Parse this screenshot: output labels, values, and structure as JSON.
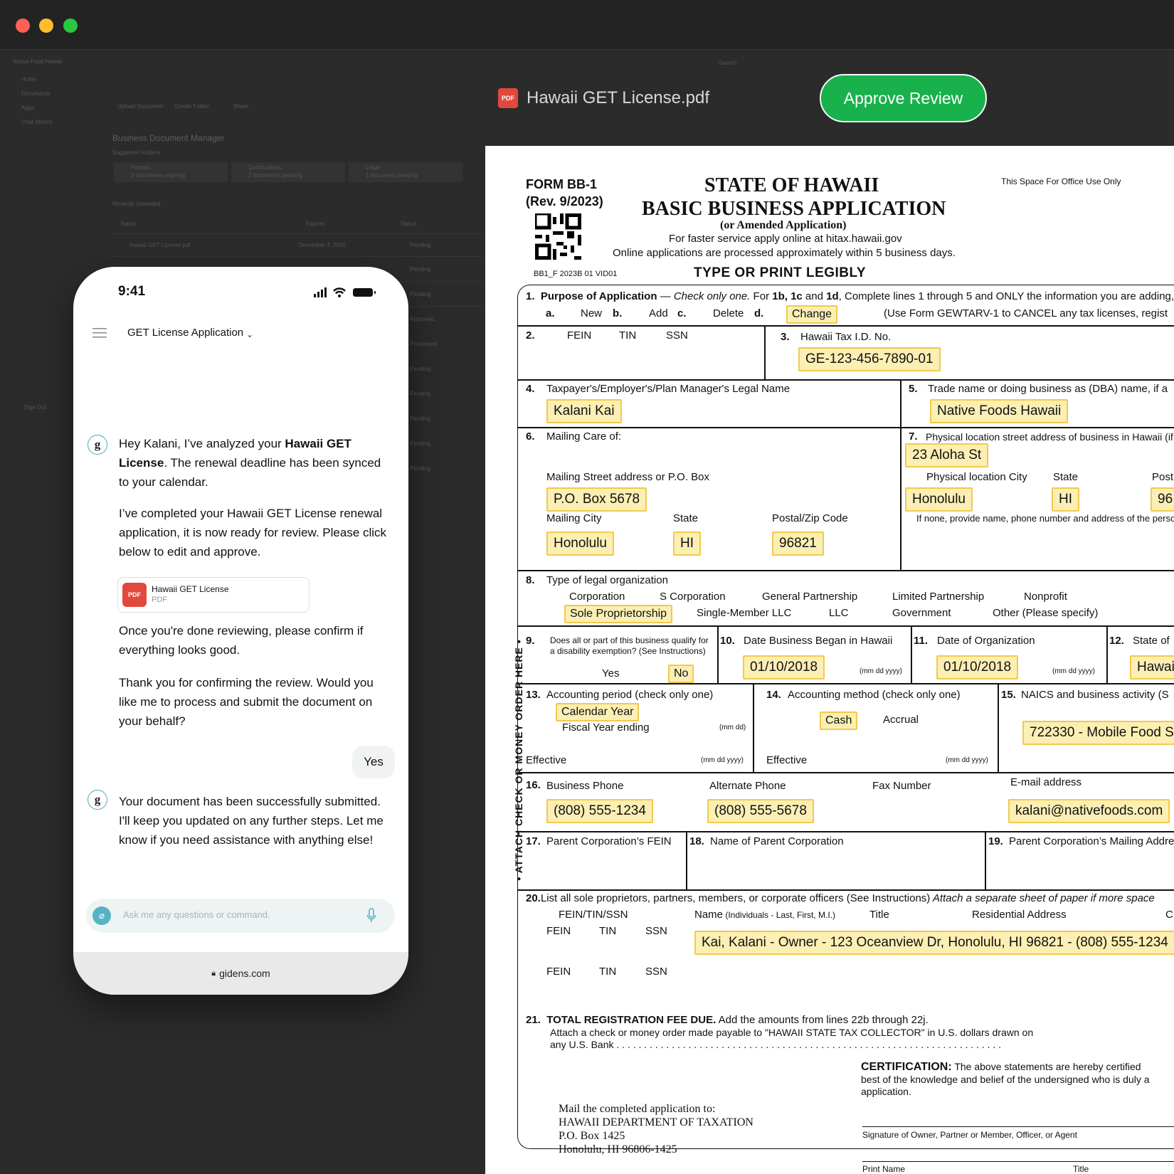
{
  "window": {
    "file_name": "Hawaii GET License.pdf",
    "file_badge": "PDF",
    "approve_label": "Approve Review"
  },
  "background_app": {
    "brand": "Native Food Hawaii",
    "nav": [
      "Home",
      "Documents",
      "Apps",
      "Chat History"
    ],
    "sign_out": "Sign Out",
    "actions": [
      "Upload Document",
      "Create Folder",
      "Share"
    ],
    "search_placeholder": "Search",
    "title": "Business Document Manager",
    "suggested": "Suggested Folders",
    "folders": [
      {
        "name": "Permits",
        "sub": "3 documents expiring"
      },
      {
        "name": "Certifications",
        "sub": "2 documents pending"
      },
      {
        "name": "Legal",
        "sub": "1 document pending"
      }
    ],
    "recent": "Recently Uploaded",
    "columns": [
      "Name",
      "Expires",
      "Status"
    ],
    "first_row": {
      "name": "Hawaii GET License.pdf",
      "date": "December 4, 2025"
    },
    "statuses": [
      "Pending",
      "Pending",
      "Pending",
      "Approved",
      "Processed",
      "Pending",
      "Pending",
      "Pending",
      "Pending",
      "Pending"
    ]
  },
  "phone": {
    "time": "9:41",
    "header_title": "GET License Application",
    "msg1_a": "Hey Kalani, I’ve analyzed your ",
    "msg1_b": "Hawaii GET License",
    "msg1_c": ". The renewal deadline has been synced to your calendar.",
    "msg2": "I’ve completed your Hawaii GET License renewal application, it is now ready for review. Please click below to edit and approve.",
    "attachment": {
      "badge": "PDF",
      "title": "Hawaii GET License",
      "type": "PDF"
    },
    "msg3": "Once you're done reviewing, please confirm if everything looks good.",
    "msg4": "Thank you for confirming the review. Would you like me to process and submit the document on your behalf?",
    "user_reply": "Yes",
    "msg5": "Your document has been successfully submitted. I'll keep you updated on any further steps. Let me know if you need assistance with anything else!",
    "input_placeholder": "Ask me any questions or command.",
    "url": "gidens.com",
    "avatar_letter": "g"
  },
  "form": {
    "form_id": "FORM BB-1",
    "rev": "(Rev. 9/2023)",
    "state": "STATE OF HAWAII",
    "title": "BASIC BUSINESS APPLICATION",
    "subtitle": "(or Amended Application)",
    "faster": "For faster service apply online at hitax.hawaii.gov",
    "online": "Online applications are processed approximately within 5 business days.",
    "office": "This Space For Office Use Only",
    "code": "BB1_F 2023B 01 VID01",
    "legibly": "TYPE OR PRINT LEGIBLY",
    "side": "• ATTACH CHECK OR MONEY ORDER HERE •",
    "l1_num": "1.",
    "l1_label": "Purpose of Application",
    "l1_check": " — Check only one.",
    "l1_rest_a": "  For ",
    "l1_rest_b": "1b, 1c",
    "l1_rest_c": " and ",
    "l1_rest_d": "1d",
    "l1_rest_e": ", Complete lines 1 through 5 and ONLY the information you are adding,",
    "opt_a": "a.",
    "opt_new": "New",
    "opt_b": "b.",
    "opt_add": "Add",
    "opt_c": "c.",
    "opt_delete": "Delete",
    "opt_d": "d.",
    "change": "Change",
    "cancel_note": "(Use Form GEWTARV-1 to CANCEL any tax licenses, regist",
    "l2_num": "2.",
    "fein": "FEIN",
    "tin": "TIN",
    "ssn": "SSN",
    "l3_num": "3.",
    "l3_label": "Hawaii Tax I.D. No.",
    "tax_id": "GE-123-456-7890-01",
    "l4_num": "4.",
    "l4_label": "Taxpayer's/Employer's/Plan Manager's Legal Name",
    "legal_name": "Kalani Kai",
    "l5_num": "5.",
    "l5_label": "Trade name or doing business as (DBA) name, if a",
    "dba": "Native Foods Hawaii",
    "l6_num": "6.",
    "l6_label": "Mailing Care of:",
    "mail_street_label": "Mailing Street address or P.O. Box",
    "mail_street": "P.O. Box 5678",
    "mail_city_label": "Mailing City",
    "mail_city": "Honolulu",
    "state_label": "State",
    "mail_state": "HI",
    "zip_label": "Postal/Zip Code",
    "mail_zip": "96821",
    "l7_num": "7.",
    "l7_label": "Physical location street address of business in Hawaii (if",
    "phys_street": "23 Aloha St",
    "phys_city_label": "Physical location City",
    "phys_city": "Honolulu",
    "phys_state": "HI",
    "phys_zip_label": "Post",
    "phys_zip": "96",
    "l7_note": "If none, provide name, phone number and address of the person",
    "l8_num": "8.",
    "l8_label": "Type of legal organization",
    "org": {
      "corp": "Corporation",
      "scorp": "S Corporation",
      "gp": "General Partnership",
      "lp": "Limited Partnership",
      "np": "Nonprofit",
      "sole": "Sole Proprietorship",
      "smllc": "Single-Member LLC",
      "llc": "LLC",
      "gov": "Government",
      "other": "Other (Please specify)"
    },
    "l9_num": "9.",
    "l9_label_1": "Does all or part of this business qualify for",
    "l9_label_2": "a disability exemption? (See Instructions)",
    "yes": "Yes",
    "no": "No",
    "l10_num": "10.",
    "l10_label": "Date Business Began in Hawaii",
    "date_began": "01/10/2018",
    "mmddyyyy": "(mm dd yyyy)",
    "l11_num": "11.",
    "l11_label": "Date of Organization",
    "date_org": "01/10/2018",
    "l12_num": "12.",
    "l12_label": "State of",
    "l12_value": "Hawai",
    "l13_num": "13.",
    "l13_label": "Accounting period (check only one)",
    "calendar_year": "Calendar Year",
    "fiscal": "Fiscal Year ending",
    "mmdd": "(mm dd)",
    "effective": "Effective",
    "l14_num": "14.",
    "l14_label": "Accounting method (check only one)",
    "cash": "Cash",
    "accrual": "Accrual",
    "l15_num": "15.",
    "l15_label": "NAICS and business activity (S",
    "naics": "722330 - Mobile Food Se",
    "l16_num": "16.",
    "l16_label": "Business Phone",
    "phone": "(808) 555-1234",
    "alt_label": "Alternate Phone",
    "alt_phone": "(808) 555-5678",
    "fax_label": "Fax Number",
    "email_label": "E-mail address",
    "email": "kalani@nativefoods.com",
    "l17_num": "17.",
    "l17_label": "Parent Corporation’s FEIN",
    "l18_num": "18.",
    "l18_label": "Name of Parent Corporation",
    "l19_num": "19.",
    "l19_label": "Parent Corporation’s Mailing Addre",
    "l20_num": "20.",
    "l20_label": "List all sole proprietors, partners, members, or corporate officers (See Instructions)",
    "l20_italic": " Attach a separate sheet of paper if more space",
    "feintinssn": "FEIN/TIN/SSN",
    "name_label": "Name",
    "name_sub": " (Individuals - Last, First, M.I.)",
    "title_label": "Title",
    "res_label": "Residential Address",
    "c_label": "C",
    "officer": "Kai, Kalani - Owner - 123 Oceanview Dr, Honolulu, HI 96821 - (808) 555-1234",
    "l21_num": "21.",
    "l21_label": "TOTAL REGISTRATION FEE DUE.",
    "l21_rest": " Add the amounts from lines 22b through 22j.",
    "l21_line2": "Attach a check or money order made payable to \"HAWAII STATE TAX COLLECTOR\" in U.S. dollars drawn on",
    "l21_line3": "any U.S. Bank . . . . . . . . . . . . . . . . . . . . . . . . . . . . . . . . . . . . . . . . . . . . . . . . . . . . . . . . . . . . . . . . . . . . . .",
    "cert_label": "CERTIFICATION:",
    "cert_1": " The above statements are hereby certified",
    "cert_2": "best of the knowledge and belief of the undersigned who is duly a",
    "cert_3": "application.",
    "mail_1": "Mail the completed application to:",
    "mail_2": "HAWAII DEPARTMENT OF TAXATION",
    "mail_3": "P.O. Box 1425",
    "mail_4": "Honolulu, HI 96806-1425",
    "sig_label": "Signature of Owner, Partner or Member, Officer, or Agent",
    "print_name": "Print Name",
    "title_sig": "Title"
  },
  "colors": {
    "approve": "#18b14b",
    "highlight": "#fcefb4",
    "highlight_border": "#f2c94c",
    "pdf_red": "#e2483d",
    "accent_teal": "#49a9b6"
  },
  "icons": [
    "close-dot",
    "minimize-dot",
    "zoom-dot",
    "pdf-icon",
    "menu-icon",
    "chevron-down-icon",
    "signal-icon",
    "wifi-icon",
    "battery-icon",
    "assistant-avatar-icon",
    "attach-icon",
    "mic-icon",
    "lock-icon",
    "qr-code"
  ]
}
